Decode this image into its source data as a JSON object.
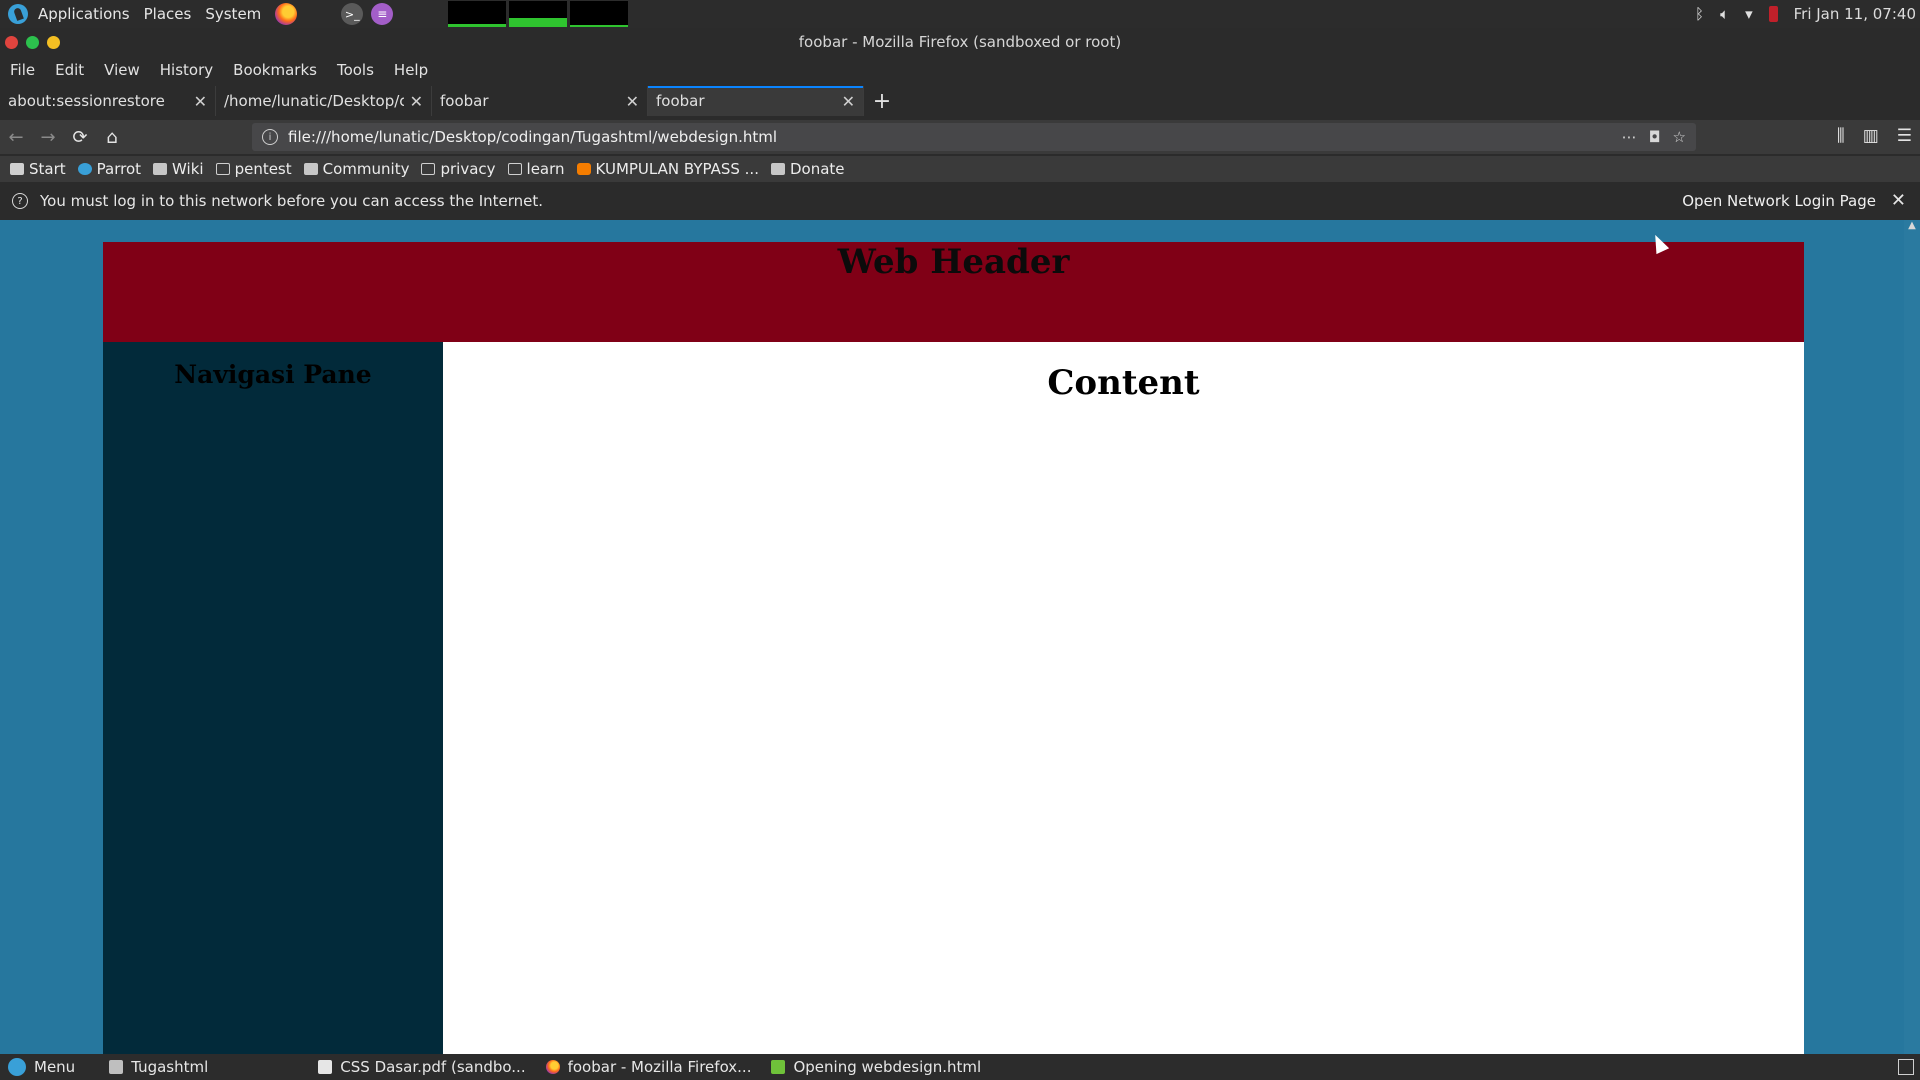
{
  "system_panel": {
    "menus": [
      "Applications",
      "Places",
      "System"
    ],
    "clock": "Fri Jan 11, 07:40"
  },
  "window": {
    "title": "foobar - Mozilla Firefox (sandboxed or root)"
  },
  "menubar": {
    "items": [
      "File",
      "Edit",
      "View",
      "History",
      "Bookmarks",
      "Tools",
      "Help"
    ]
  },
  "tabs": [
    {
      "label": "about:sessionrestore",
      "active": false
    },
    {
      "label": "/home/lunatic/Desktop/codi",
      "active": false
    },
    {
      "label": "foobar",
      "active": false
    },
    {
      "label": "foobar",
      "active": true
    }
  ],
  "navbar": {
    "url": "file:///home/lunatic/Desktop/codingan/Tugashtml/webdesign.html"
  },
  "bookmarks": [
    {
      "label": "Start",
      "icon": "start-icon"
    },
    {
      "label": "Parrot",
      "icon": "parrot-icon"
    },
    {
      "label": "Wiki",
      "icon": "wiki-icon"
    },
    {
      "label": "pentest",
      "icon": "folder-icon"
    },
    {
      "label": "Community",
      "icon": "community-icon"
    },
    {
      "label": "privacy",
      "icon": "folder-icon"
    },
    {
      "label": "learn",
      "icon": "folder-icon"
    },
    {
      "label": "KUMPULAN BYPASS ...",
      "icon": "blogger-icon"
    },
    {
      "label": "Donate",
      "icon": "donate-icon"
    }
  ],
  "notification": {
    "message": "You must log in to this network before you can access the Internet.",
    "button": "Open Network Login Page"
  },
  "page": {
    "header": "Web Header",
    "nav_title": "Navigasi Pane",
    "content_title": "Content",
    "colors": {
      "background": "#26779e",
      "header": "#800016",
      "nav": "#022a3a",
      "content": "#ffffff"
    }
  },
  "taskbar": {
    "items": [
      {
        "label": "Menu",
        "icon": "parrot-icon"
      },
      {
        "label": "Tugashtml",
        "icon": "folder-icon"
      },
      {
        "label": "CSS Dasar.pdf (sandbo...",
        "icon": "pdf-icon"
      },
      {
        "label": "foobar - Mozilla Firefox...",
        "icon": "firefox-icon"
      },
      {
        "label": "Opening webdesign.html",
        "icon": "document-icon"
      }
    ]
  }
}
